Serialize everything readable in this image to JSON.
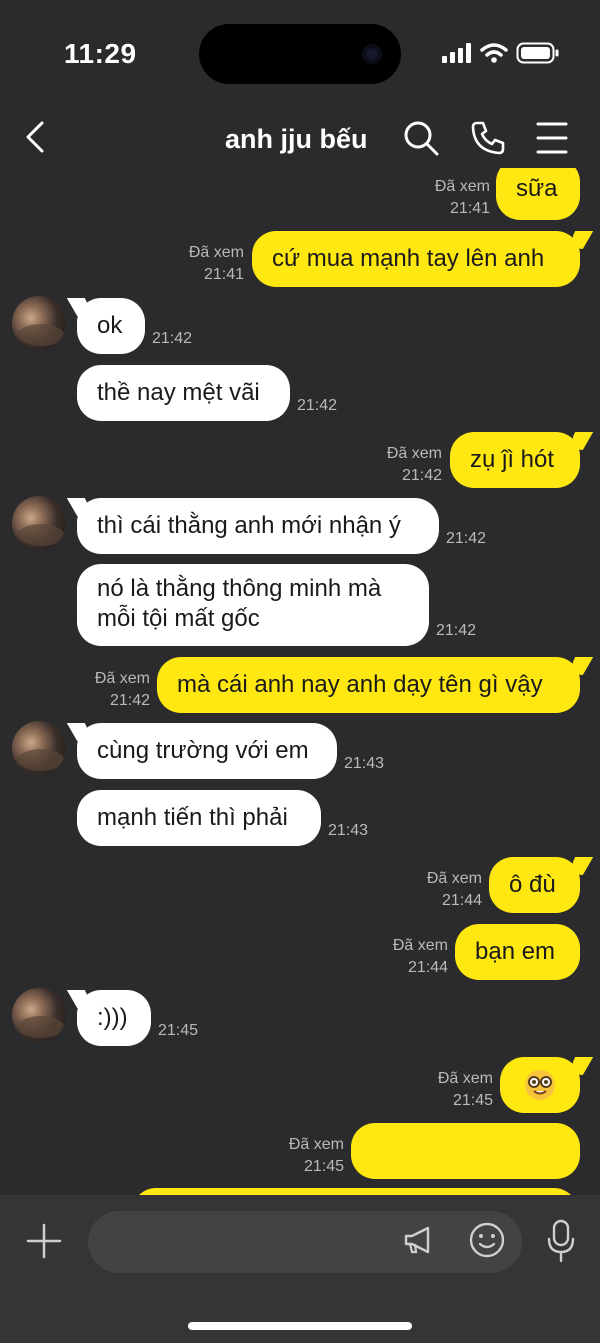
{
  "status": {
    "time": "11:29"
  },
  "header": {
    "title": "anh jju bếu"
  },
  "messages": [
    {
      "dir": "out",
      "text": "sữa",
      "seen": "Đã xem",
      "time": "21:41"
    },
    {
      "dir": "out",
      "text": "cứ mua mạnh tay lên anh",
      "seen": "Đã xem",
      "time": "21:41"
    },
    {
      "dir": "in",
      "text": "ok",
      "time": "21:42"
    },
    {
      "dir": "in",
      "text": "thề nay mệt vãi",
      "time": "21:42"
    },
    {
      "dir": "out",
      "text": "zụ ĵì hót",
      "seen": "Đã xem",
      "time": "21:42"
    },
    {
      "dir": "in",
      "text": "thì cái thằng anh mới nhận ý",
      "time": "21:42"
    },
    {
      "dir": "in",
      "text": "nó là thằng thông minh mà mỗi tội mất gốc",
      "time": "21:42"
    },
    {
      "dir": "out",
      "text": "mà cái anh nay anh dạy tên gì vậy",
      "seen": "Đã xem",
      "time": "21:42"
    },
    {
      "dir": "in",
      "text": "cùng trường với em",
      "time": "21:43"
    },
    {
      "dir": "in",
      "text": "mạnh tiến thì phải",
      "time": "21:43"
    },
    {
      "dir": "out",
      "text": "ô đù",
      "seen": "Đã xem",
      "time": "21:44"
    },
    {
      "dir": "out",
      "text": "bạn em",
      "seen": "Đã xem",
      "time": "21:44"
    },
    {
      "dir": "in",
      "text": ":)))",
      "time": "21:45"
    },
    {
      "dir": "out",
      "text": "🤓",
      "seen": "Đã xem",
      "time": "21:45"
    },
    {
      "dir": "out",
      "text": "",
      "seen": "Đã xem",
      "time": "21:45"
    }
  ],
  "icons": {
    "back": "chevron-left-icon",
    "search": "search-icon",
    "call": "phone-icon",
    "menu": "menu-icon",
    "plus": "plus-icon",
    "megaphone": "megaphone-icon",
    "emoji": "emoji-icon",
    "mic": "mic-icon"
  },
  "colors": {
    "background": "#2b2b2d",
    "outgoing": "#ffe812",
    "incoming": "#ffffff",
    "meta": "#b9b9b9"
  }
}
